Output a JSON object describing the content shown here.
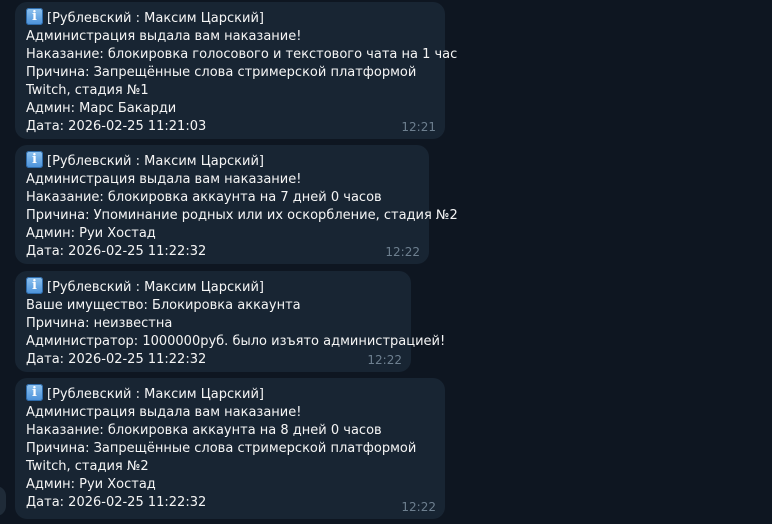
{
  "messages": [
    {
      "header": "[Рублевский : Максим Царский]",
      "lines": [
        "Администрация выдала вам наказание!",
        "Наказание: блокировка голосового и текстового чата на 1 час",
        "Причина: Запрещённые слова стримерской платформой Twitch, стадия №1",
        "Админ: Марс Бакарди",
        "Дата: 2026-02-25 11:21:03"
      ],
      "time": "12:21"
    },
    {
      "header": "[Рублевский : Максим Царский]",
      "lines": [
        "Администрация выдала вам наказание!",
        "Наказание: блокировка аккаунта на 7 дней 0 часов",
        "Причина: Упоминание родных или их оскорбление, стадия №2",
        "Админ: Руи Хостад",
        "Дата: 2026-02-25 11:22:32"
      ],
      "time": "12:22"
    },
    {
      "header": "[Рублевский : Максим Царский]",
      "lines": [
        "Ваше имущество: Блокировка аккаунта",
        "Причина: неизвестна",
        "Администратор: 1000000руб. было изъято администрацией!",
        "Дата: 2026-02-25 11:22:32"
      ],
      "time": "12:22"
    },
    {
      "header": "[Рублевский : Максим Царский]",
      "lines": [
        "Администрация выдала вам наказание!",
        "Наказание: блокировка аккаунта на 8 дней 0 часов",
        "Причина: Запрещённые слова стримерской платформой Twitch, стадия №2",
        "Админ: Руи Хостад",
        "Дата: 2026-02-25 11:22:32"
      ],
      "time": "12:22"
    }
  ],
  "colors": {
    "background": "#0e1621",
    "bubble": "#182533",
    "text": "#f5f5f5",
    "time": "#6d7f8f"
  },
  "icons": {
    "header_icon": "info-icon"
  }
}
